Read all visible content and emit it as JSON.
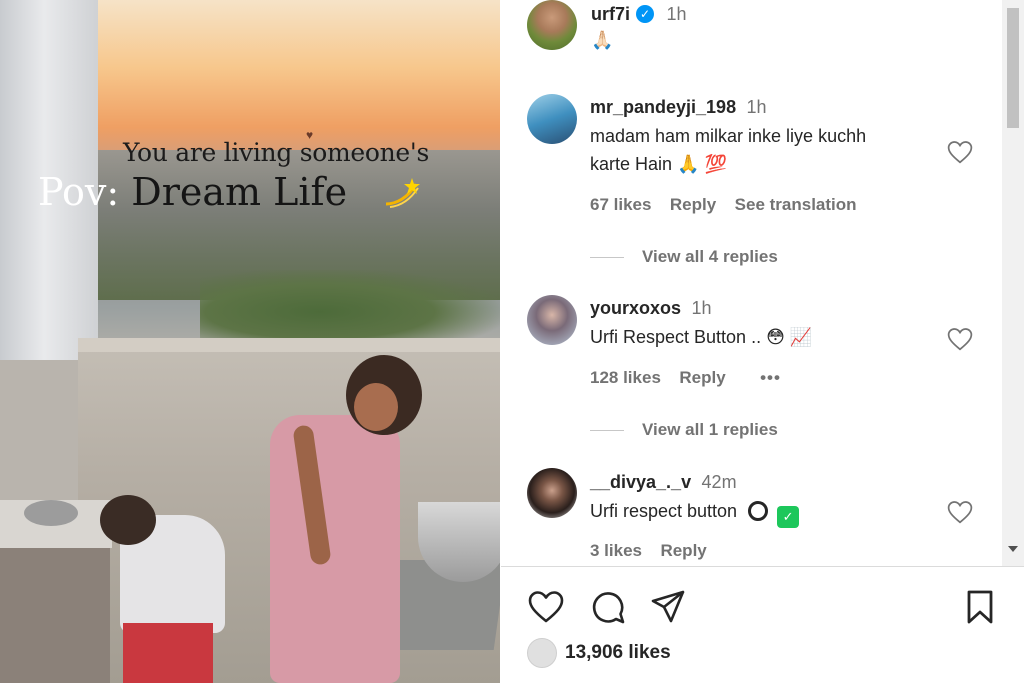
{
  "media": {
    "overlay_line1": "You are living someone's",
    "overlay_pov": "Pov:",
    "overlay_dream": " Dream Life"
  },
  "post": {
    "username": "urf7i",
    "time": "1h",
    "caption_emoji": "🙏🏻"
  },
  "comments": [
    {
      "username": "mr_pandeyji_198",
      "time": "1h",
      "text_line1": "madam ham milkar inke liye kuchh",
      "text_line2": "karte Hain 🙏 💯",
      "likes": "67 likes",
      "reply": "Reply",
      "translation": "See translation",
      "view_replies": "View all 4 replies"
    },
    {
      "username": "yourxoxos",
      "time": "1h",
      "text": "Urfi Respect Button .. 😳 📈",
      "likes": "128 likes",
      "reply": "Reply",
      "more": "•••",
      "view_replies": "View all 1 replies"
    },
    {
      "username": "__divya_._v",
      "time": "42m",
      "text": "Urfi respect button",
      "likes": "3 likes",
      "reply": "Reply"
    }
  ],
  "footer": {
    "likes": "13,906 likes"
  },
  "icons": {
    "like": "heart-icon",
    "comment": "comment-icon",
    "share": "share-icon",
    "save": "bookmark-icon",
    "verified": "verified-badge-icon"
  },
  "colors": {
    "accent": "#0095f6",
    "text": "#262626",
    "muted": "#737373",
    "check_green": "#1dc75b"
  }
}
